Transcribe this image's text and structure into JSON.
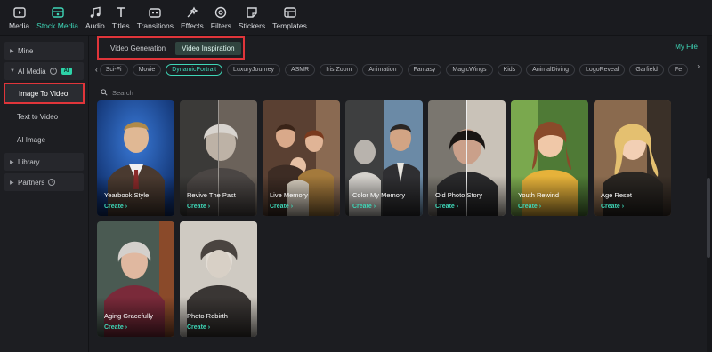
{
  "toolbar": {
    "items": [
      {
        "label": "Media",
        "icon": "media-icon"
      },
      {
        "label": "Stock Media",
        "icon": "stock-media-icon",
        "active": true
      },
      {
        "label": "Audio",
        "icon": "audio-icon"
      },
      {
        "label": "Titles",
        "icon": "titles-icon"
      },
      {
        "label": "Transitions",
        "icon": "transitions-icon"
      },
      {
        "label": "Effects",
        "icon": "effects-icon"
      },
      {
        "label": "Filters",
        "icon": "filters-icon"
      },
      {
        "label": "Stickers",
        "icon": "stickers-icon"
      },
      {
        "label": "Templates",
        "icon": "templates-icon"
      }
    ]
  },
  "sidebar": {
    "mine": "Mine",
    "ai_media": "AI Media",
    "ai_badge": "AI",
    "sub_items": [
      "Image To Video",
      "Text to Video",
      "AI Image"
    ],
    "library": "Library",
    "partners": "Partners"
  },
  "main": {
    "tabs": [
      {
        "label": "Video Generation",
        "active": false
      },
      {
        "label": "Video Inspiration",
        "active": true
      }
    ],
    "my_file": "My File",
    "chips": [
      "Sci-Fi",
      "Movie",
      "DynamicPortrait",
      "LuxuryJourney",
      "ASMR",
      "Iris Zoom",
      "Animation",
      "Fantasy",
      "MagicWings",
      "Kids",
      "AnimalDiving",
      "LogoReveal",
      "Garfield",
      "Fe"
    ],
    "active_chip": "DynamicPortrait",
    "search_placeholder": "Search",
    "create_label": "Create",
    "cards": [
      {
        "title": "Yearbook Style"
      },
      {
        "title": "Revive The Past"
      },
      {
        "title": "Live Memory"
      },
      {
        "title": "Color My Memory"
      },
      {
        "title": "Old Photo Story"
      },
      {
        "title": "Youth Rewind"
      },
      {
        "title": "Age Reset"
      },
      {
        "title": "Aging Gracefully"
      },
      {
        "title": "Photo Rebirth"
      }
    ]
  },
  "colors": {
    "accent": "#3ed6b7",
    "highlight_box": "#e0353a",
    "background": "#1c1d21"
  }
}
